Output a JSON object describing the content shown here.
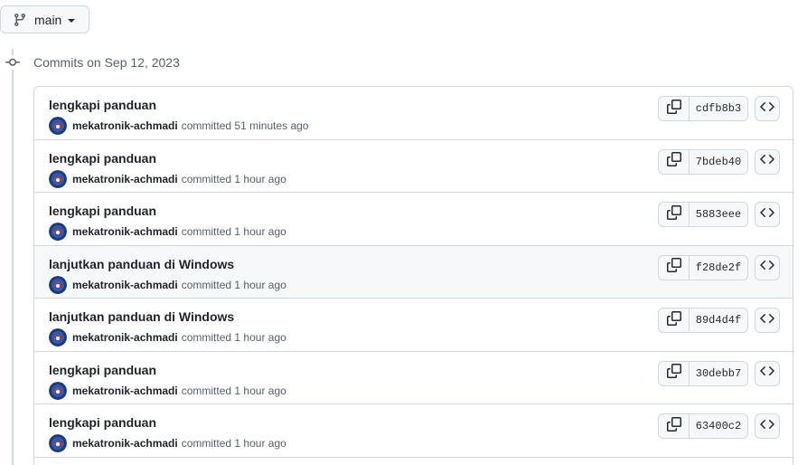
{
  "branch": {
    "name": "main"
  },
  "commits_heading": "Commits on Sep 12, 2023",
  "commits": [
    {
      "title": "lengkapi panduan",
      "author": "mekatronik-achmadi",
      "action": "committed",
      "time": "51 minutes ago",
      "sha": "cdfb8b3"
    },
    {
      "title": "lengkapi panduan",
      "author": "mekatronik-achmadi",
      "action": "committed",
      "time": "1 hour ago",
      "sha": "7bdeb40"
    },
    {
      "title": "lengkapi panduan",
      "author": "mekatronik-achmadi",
      "action": "committed",
      "time": "1 hour ago",
      "sha": "5883eee"
    },
    {
      "title": "lanjutkan panduan di Windows",
      "author": "mekatronik-achmadi",
      "action": "committed",
      "time": "1 hour ago",
      "sha": "f28de2f"
    },
    {
      "title": "lanjutkan panduan di Windows",
      "author": "mekatronik-achmadi",
      "action": "committed",
      "time": "1 hour ago",
      "sha": "89d4d4f"
    },
    {
      "title": "lengkapi panduan",
      "author": "mekatronik-achmadi",
      "action": "committed",
      "time": "1 hour ago",
      "sha": "30debb7"
    },
    {
      "title": "lengkapi panduan",
      "author": "mekatronik-achmadi",
      "action": "committed",
      "time": "1 hour ago",
      "sha": "63400c2"
    }
  ],
  "hovered_row": 3,
  "icons": {
    "branch": "git-branch-icon",
    "commit": "git-commit-icon",
    "copy": "copy-icon",
    "browse": "code-icon"
  },
  "colors": {
    "border": "#d0d7de",
    "muted_text": "#57606a",
    "button_bg": "#f6f8fa"
  }
}
